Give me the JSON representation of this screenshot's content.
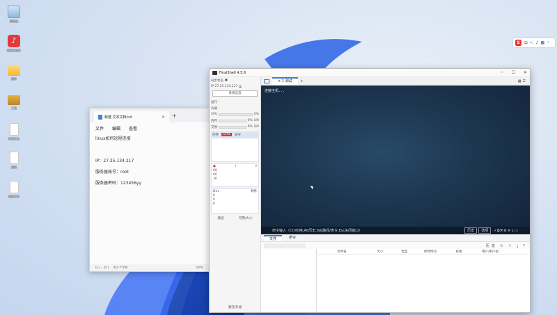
{
  "desktop": {
    "icons": [
      {
        "name": "回收站"
      },
      {
        "name": "网易云音乐"
      },
      {
        "name": "资料"
      },
      {
        "name": "工具"
      },
      {
        "name": "新建文本"
      },
      {
        "name": "说明"
      },
      {
        "name": "配置文件"
      }
    ]
  },
  "ime": {
    "logo": "S",
    "mode": "中"
  },
  "notepad": {
    "tab_title": "新建 文本文档.txt",
    "menu": [
      "文件",
      "编辑",
      "查看"
    ],
    "lines": [
      "linux如何远程连接",
      "",
      "IP：27.25.134.217",
      "服务器账号：root",
      "服务器密码：123456yy"
    ],
    "status": {
      "pos": "行 1，列 1",
      "chars": "444 个字符",
      "zoom": "100%"
    }
  },
  "finalshell": {
    "title": "FinalShell 4.5.6",
    "left": {
      "sync_label": "同步状态",
      "ip": "IP  27.25.134.217",
      "sysinfo_button": "系统信息",
      "running": "运行 -",
      "load": "负载 -",
      "cpu_label": "CPU",
      "cpu_val": "0%",
      "mem_label": "内存",
      "mem_val": "0%",
      "mem_right": "0/0",
      "swap_label": "交换",
      "swap_val": "0%",
      "swap_right": "0/0",
      "proc_mem": "内存",
      "proc_cpu": "CPU",
      "proc_cmd": "命令",
      "net_vals": [
        "60",
        "60",
        "30"
      ],
      "disk_head": "Dev",
      "disk_right": "剩余",
      "disk_vals": [
        "0",
        "0",
        "0"
      ],
      "path_label": "路径",
      "size_label": "可用/大小",
      "footer": "激活/升级"
    },
    "tab": {
      "name": "1 测试"
    },
    "terminal": {
      "prompt": "连接主机...",
      "cmd_hint": "命令输入（Ctrl切换,Alt历史,Tab路径/命令,Esc关闭窗口）",
      "history_btn": "历史",
      "options_btn": "选项"
    },
    "file_manager": {
      "tabs": [
        "文件",
        "命令"
      ],
      "history": "历史",
      "columns": [
        "文件名",
        "大小",
        "类型",
        "修改时间",
        "权限",
        "用户/用户组"
      ]
    }
  }
}
